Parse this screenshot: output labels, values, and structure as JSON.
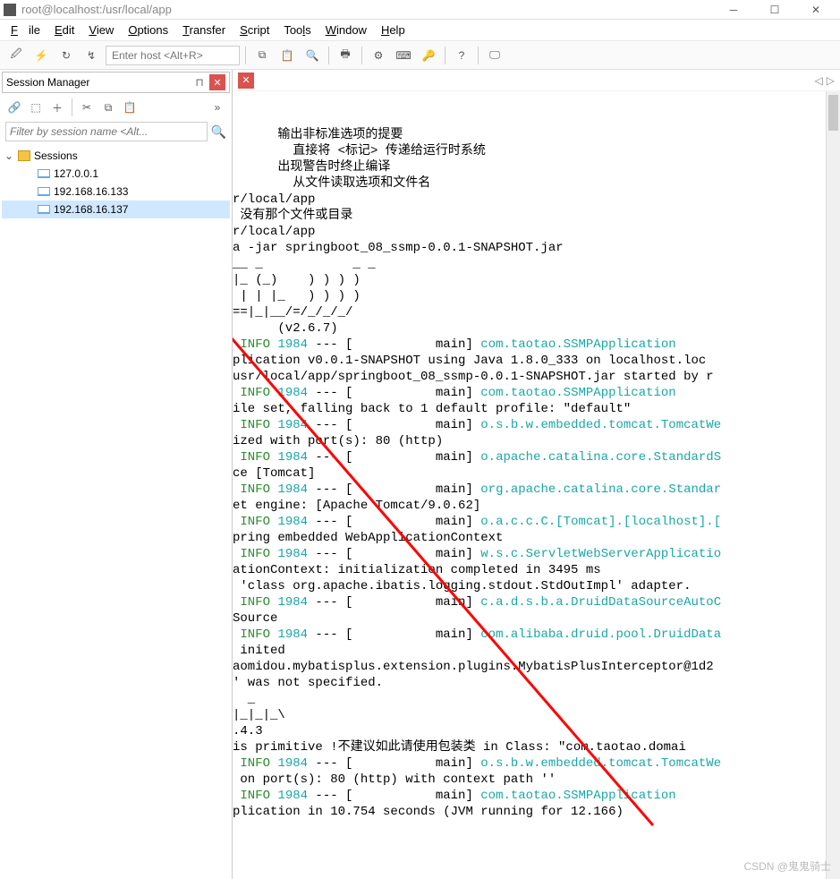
{
  "window": {
    "title": "root@localhost:/usr/local/app"
  },
  "menus": {
    "file": "File",
    "edit": "Edit",
    "view": "View",
    "options": "Options",
    "transfer": "Transfer",
    "script": "Script",
    "tools": "Tools",
    "window": "Window",
    "help": "Help"
  },
  "host_placeholder": "Enter host <Alt+R>",
  "session_manager": {
    "title": "Session Manager",
    "filter_placeholder": "Filter by session name <Alt...",
    "root": "Sessions",
    "items": [
      {
        "label": "127.0.0.1",
        "selected": false
      },
      {
        "label": "192.168.16.133",
        "selected": false
      },
      {
        "label": "192.168.16.137",
        "selected": true
      }
    ]
  },
  "terminal": {
    "lines": [
      {
        "t": "      输出非标准选项的提要"
      },
      {
        "t": "        直接将 <标记> 传递给运行时系统"
      },
      {
        "t": "      出现警告时终止编译"
      },
      {
        "t": "        从文件读取选项和文件名"
      },
      {
        "t": ""
      },
      {
        "t": "r/local/app"
      },
      {
        "t": " 没有那个文件或目录"
      },
      {
        "t": ""
      },
      {
        "t": "r/local/app"
      },
      {
        "t": "a -jar springboot_08_ssmp-0.0.1-SNAPSHOT.jar"
      },
      {
        "t": ""
      },
      {
        "t": ""
      },
      {
        "t": "__ _            _ _"
      },
      {
        "t": "|_ (_)    ) ) ) )"
      },
      {
        "t": " | | |_   ) ) ) )"
      },
      {
        "t": "==|_|__/=/_/_/_/"
      },
      {
        "t": "      (v2.6.7)"
      },
      {
        "t": ""
      },
      {
        "segs": [
          {
            "c": "g",
            "t": " INFO"
          },
          {
            "t": " "
          },
          {
            "c": "c",
            "t": "1984"
          },
          {
            "t": " --- [           main] "
          },
          {
            "c": "c",
            "t": "com.taotao.SSMPApplication"
          }
        ]
      },
      {
        "t": "plication v0.0.1-SNAPSHOT using Java 1.8.0_333 on localhost.loc"
      },
      {
        "t": "usr/local/app/springboot_08_ssmp-0.0.1-SNAPSHOT.jar started by r"
      },
      {
        "t": ""
      },
      {
        "segs": [
          {
            "c": "g",
            "t": " INFO"
          },
          {
            "t": " "
          },
          {
            "c": "c",
            "t": "1984"
          },
          {
            "t": " --- [           main] "
          },
          {
            "c": "c",
            "t": "com.taotao.SSMPApplication"
          }
        ]
      },
      {
        "t": "ile set, falling back to 1 default profile: \"default\""
      },
      {
        "segs": [
          {
            "c": "g",
            "t": " INFO"
          },
          {
            "t": " "
          },
          {
            "c": "c",
            "t": "1984"
          },
          {
            "t": " --- [           main] "
          },
          {
            "c": "c",
            "t": "o.s.b.w.embedded.tomcat.TomcatWe"
          }
        ]
      },
      {
        "t": "ized with port(s): 80 (http)"
      },
      {
        "segs": [
          {
            "c": "g",
            "t": " INFO"
          },
          {
            "t": " "
          },
          {
            "c": "c",
            "t": "1984"
          },
          {
            "t": " --- [           main] "
          },
          {
            "c": "c",
            "t": "o.apache.catalina.core.StandardS"
          }
        ]
      },
      {
        "t": "ce [Tomcat]"
      },
      {
        "segs": [
          {
            "c": "g",
            "t": " INFO"
          },
          {
            "t": " "
          },
          {
            "c": "c",
            "t": "1984"
          },
          {
            "t": " --- [           main] "
          },
          {
            "c": "c",
            "t": "org.apache.catalina.core.Standar"
          }
        ]
      },
      {
        "t": "et engine: [Apache Tomcat/9.0.62]"
      },
      {
        "segs": [
          {
            "c": "g",
            "t": " INFO"
          },
          {
            "t": " "
          },
          {
            "c": "c",
            "t": "1984"
          },
          {
            "t": " --- [           main] "
          },
          {
            "c": "c",
            "t": "o.a.c.c.C.[Tomcat].[localhost].["
          }
        ]
      },
      {
        "t": "pring embedded WebApplicationContext"
      },
      {
        "segs": [
          {
            "c": "g",
            "t": " INFO"
          },
          {
            "t": " "
          },
          {
            "c": "c",
            "t": "1984"
          },
          {
            "t": " --- [           main] "
          },
          {
            "c": "c",
            "t": "w.s.c.ServletWebServerApplicatio"
          }
        ]
      },
      {
        "t": "ationContext: initialization completed in 3495 ms"
      },
      {
        "t": " 'class org.apache.ibatis.logging.stdout.StdOutImpl' adapter."
      },
      {
        "segs": [
          {
            "c": "g",
            "t": " INFO"
          },
          {
            "t": " "
          },
          {
            "c": "c",
            "t": "1984"
          },
          {
            "t": " --- [           main] "
          },
          {
            "c": "c",
            "t": "c.a.d.s.b.a.DruidDataSourceAutoC"
          }
        ]
      },
      {
        "t": "Source"
      },
      {
        "segs": [
          {
            "c": "g",
            "t": " INFO"
          },
          {
            "t": " "
          },
          {
            "c": "c",
            "t": "1984"
          },
          {
            "t": " --- [           main] "
          },
          {
            "c": "c",
            "t": "com.alibaba.druid.pool.DruidData"
          }
        ]
      },
      {
        "t": " inited"
      },
      {
        "t": "aomidou.mybatisplus.extension.plugins.MybatisPlusInterceptor@1d2"
      },
      {
        "t": ""
      },
      {
        "t": "' was not specified."
      },
      {
        "t": "  _"
      },
      {
        "t": "|_|_|_\\"
      },
      {
        "t": ""
      },
      {
        "t": ".4.3"
      },
      {
        "t": "is primitive !不建议如此请使用包装类 in Class: \"com.taotao.domai"
      },
      {
        "t": ""
      },
      {
        "segs": [
          {
            "c": "g",
            "t": " INFO"
          },
          {
            "t": " "
          },
          {
            "c": "c",
            "t": "1984"
          },
          {
            "t": " --- [           main] "
          },
          {
            "c": "c",
            "t": "o.s.b.w.embedded.tomcat.TomcatWe"
          }
        ]
      },
      {
        "t": " on port(s): 80 (http) with context path ''"
      },
      {
        "segs": [
          {
            "c": "g",
            "t": " INFO"
          },
          {
            "t": " "
          },
          {
            "c": "c",
            "t": "1984"
          },
          {
            "t": " --- [           main] "
          },
          {
            "c": "c",
            "t": "com.taotao.SSMPApplication"
          }
        ]
      },
      {
        "t": "plication in 10.754 seconds (JVM running for 12.166)"
      }
    ]
  },
  "watermark": "CSDN @鬼鬼骑士"
}
